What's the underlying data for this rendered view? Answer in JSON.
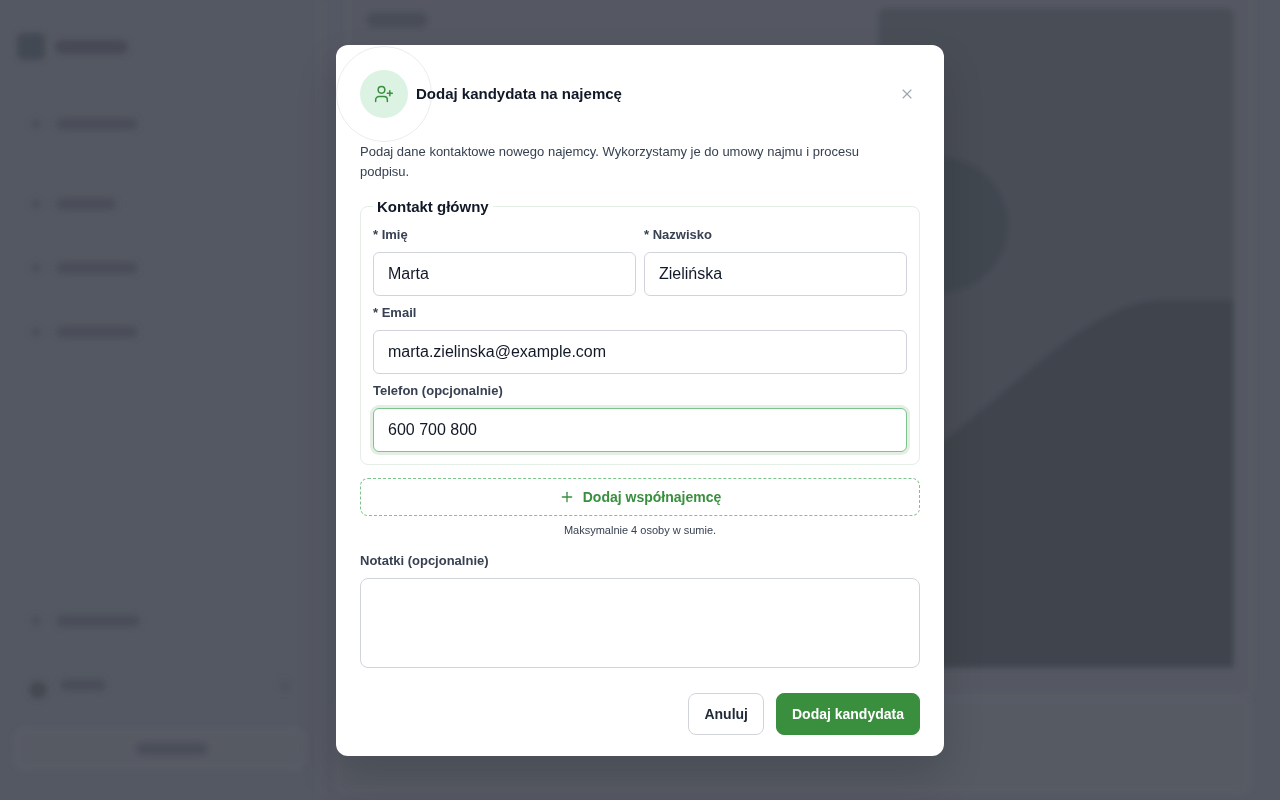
{
  "dialog": {
    "title": "Dodaj kandydata na najemcę",
    "description": "Podaj dane kontaktowe nowego najemcy. Wykorzystamy je do umowy najmu i procesu podpisu.",
    "contact_section": {
      "legend": "Kontakt główny",
      "rows": [
        {
          "fields": [
            {
              "label": "* Imię",
              "value": "Marta",
              "focused": false
            },
            {
              "label": "* Nazwisko",
              "value": "Zielińska",
              "focused": false
            }
          ]
        },
        {
          "fields": [
            {
              "label": "* Email",
              "value": "marta.zielinska@example.com",
              "focused": false
            }
          ]
        },
        {
          "fields": [
            {
              "label": "Telefon (opcjonalnie)",
              "value": "600 700 800",
              "focused": true
            }
          ]
        }
      ]
    },
    "add_cotenant_button": {
      "label": "Dodaj współnajemcę"
    },
    "cotenant_hint": "Maksymalnie 4 osoby w sumie.",
    "notes": {
      "label": "Notatki (opcjonalnie)"
    },
    "actions": [
      {
        "label": "Anuluj",
        "kind": "secondary"
      },
      {
        "label": "Dodaj kandydata",
        "kind": "primary"
      }
    ]
  }
}
